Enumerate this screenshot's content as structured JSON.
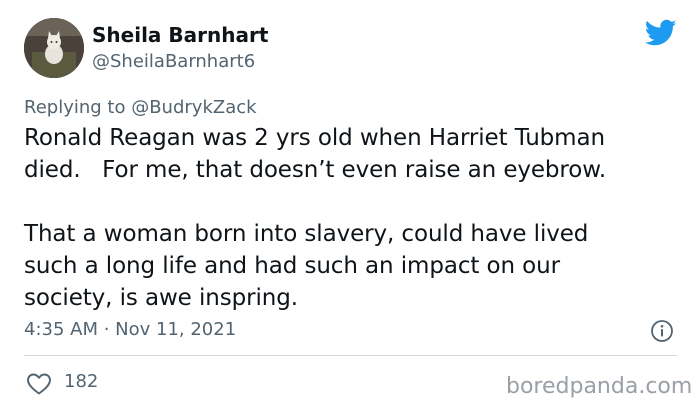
{
  "author": {
    "display_name": "Sheila Barnhart",
    "handle": "@SheilaBarnhart6"
  },
  "reply": {
    "prefix": "Replying to ",
    "target": "@BudrykZack"
  },
  "tweet": {
    "text": "Ronald Reagan was 2 yrs old when Harriet Tubman\ndied.   For me, that doesn’t even raise an eyebrow.\n\nThat a woman born into slavery, could have lived\nsuch a long life and had such an impact on our\nsociety, is awe inspring.",
    "timestamp": "4:35 AM · Nov 11, 2021",
    "likes": "182"
  },
  "watermark": "boredpanda.com",
  "colors": {
    "brand": "#1d9bf0",
    "text": "#0f1419",
    "secondary": "#536471",
    "divider": "#cfd9de"
  },
  "icons": {
    "logo": "twitter-bird-icon",
    "info": "info-icon",
    "like": "heart-icon"
  }
}
